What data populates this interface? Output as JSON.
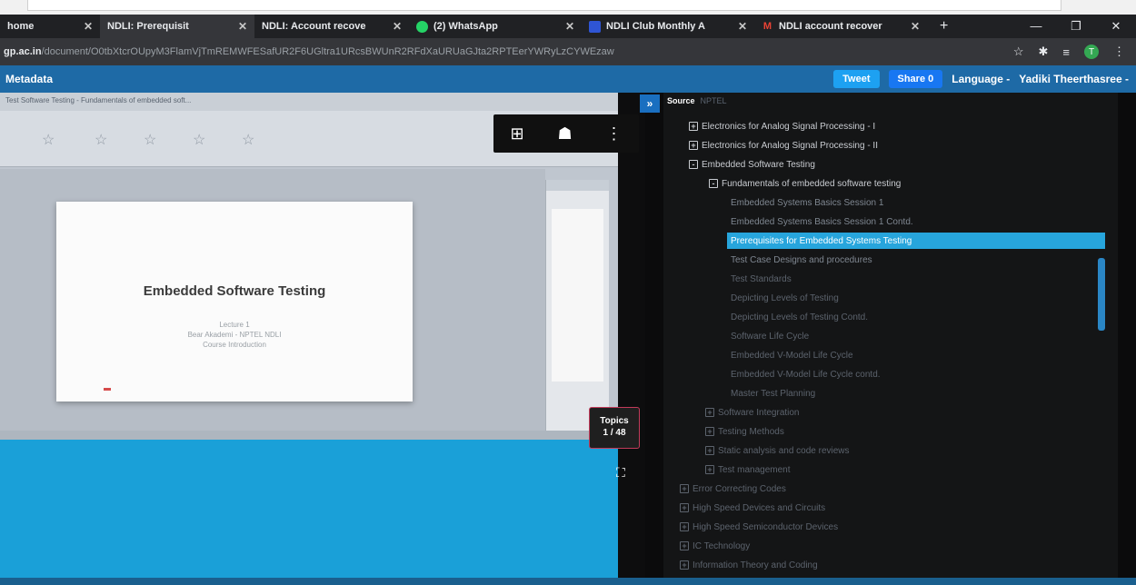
{
  "browser": {
    "tabs": [
      {
        "label": "home",
        "active": false
      },
      {
        "label": "NDLI: Prerequisit",
        "active": true
      },
      {
        "label": "NDLI: Account recove",
        "active": false
      },
      {
        "label": "(2) WhatsApp",
        "active": false,
        "icon": "whatsapp-icon"
      },
      {
        "label": "NDLI Club Monthly A",
        "active": false,
        "icon": "ndli-icon"
      },
      {
        "label": "NDLI account recover",
        "active": false,
        "icon": "gmail-icon"
      }
    ],
    "url_host": "gp.ac.in",
    "url_path": "/document/O0tbXtcrOUpyM3FlamVjTmREMWFESafUR2F6UGltra1URcsBWUnR2RFdXaURUaGJta2RPTEerYWRyLzCYWEzaw"
  },
  "header": {
    "section": "Metadata",
    "tweet_label": "Tweet",
    "share_label": "Share 0",
    "language_label": "Language -",
    "user_label": "Yadiki Theerthasree -"
  },
  "slide": {
    "window_caption": "Test Software Testing - Fundamentals of embedded soft...",
    "title": "Embedded Software Testing",
    "line1": "Lecture 1",
    "line2": "Bear Akademi - NPTEL NDLI",
    "line3": "Course Introduction"
  },
  "topics": {
    "label": "Topics",
    "count": "1 / 48"
  },
  "tree": {
    "source_label": "Source",
    "source_value": "NPTEL",
    "items": [
      {
        "label": "Electronics for Analog Signal Processing - I",
        "toggle": "+",
        "state": "bright"
      },
      {
        "label": "Electronics for Analog Signal Processing - II",
        "toggle": "+",
        "state": "bright"
      },
      {
        "label": "Embedded Software Testing",
        "toggle": "-",
        "state": "bright"
      },
      {
        "label": "Fundamentals of embedded software testing",
        "toggle": "-",
        "state": "bright"
      },
      {
        "label": "Embedded Systems Basics Session 1",
        "toggle": "",
        "state": "mid"
      },
      {
        "label": "Embedded Systems Basics Session 1 Contd.",
        "toggle": "",
        "state": "mid"
      },
      {
        "label": "Prerequisites for Embedded Systems Testing",
        "toggle": "",
        "state": "selected"
      },
      {
        "label": "Test Case Designs and procedures",
        "toggle": "",
        "state": "mid"
      },
      {
        "label": "Test Standards",
        "toggle": "",
        "state": "dim"
      },
      {
        "label": "Depicting Levels of Testing",
        "toggle": "",
        "state": "dim"
      },
      {
        "label": "Depicting Levels of Testing Contd.",
        "toggle": "",
        "state": "dim"
      },
      {
        "label": "Software Life Cycle",
        "toggle": "",
        "state": "dim"
      },
      {
        "label": "Embedded V-Model Life Cycle",
        "toggle": "",
        "state": "dim"
      },
      {
        "label": "Embedded V-Model Life Cycle contd.",
        "toggle": "",
        "state": "dim"
      },
      {
        "label": "Master Test Planning",
        "toggle": "",
        "state": "dim"
      },
      {
        "label": "Software Integration",
        "toggle": "+",
        "state": "dim"
      },
      {
        "label": "Testing Methods",
        "toggle": "+",
        "state": "dim"
      },
      {
        "label": "Static analysis and code reviews",
        "toggle": "+",
        "state": "dim"
      },
      {
        "label": "Test management",
        "toggle": "+",
        "state": "dim"
      },
      {
        "label": "Error Correcting Codes",
        "toggle": "+",
        "state": "dim"
      },
      {
        "label": "High Speed Devices and Circuits",
        "toggle": "+",
        "state": "dim"
      },
      {
        "label": "High Speed Semiconductor Devices",
        "toggle": "+",
        "state": "dim"
      },
      {
        "label": "IC Technology",
        "toggle": "+",
        "state": "dim"
      },
      {
        "label": "Information Theory and Coding",
        "toggle": "+",
        "state": "dim"
      }
    ]
  },
  "colors": {
    "header_blue": "#1e6aa6",
    "selected": "#27a5dc",
    "viewer_blue": "#1aa0d8"
  }
}
